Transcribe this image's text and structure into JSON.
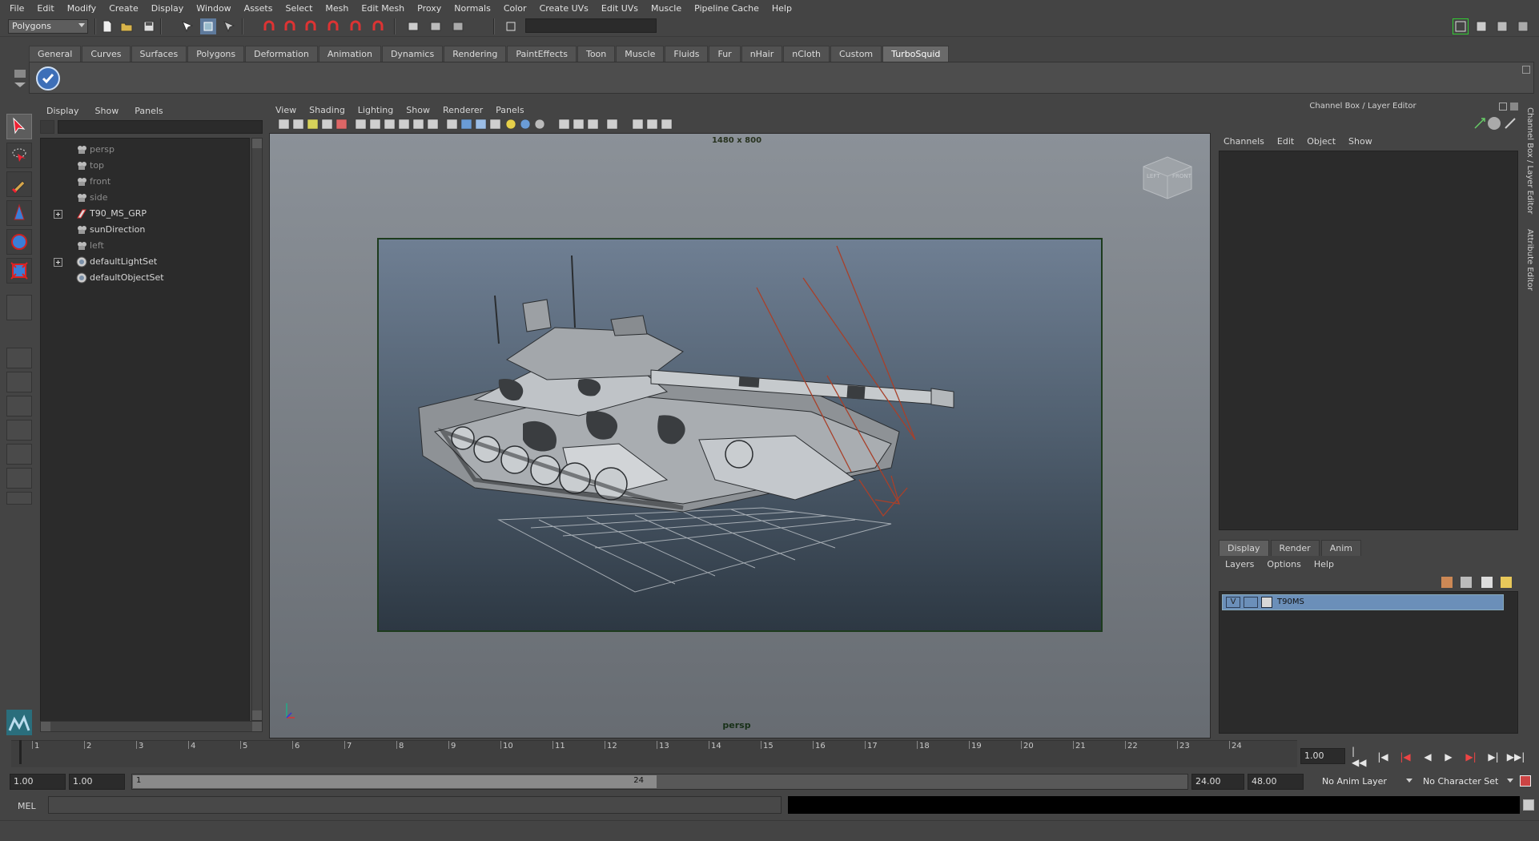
{
  "menubar": [
    "File",
    "Edit",
    "Modify",
    "Create",
    "Display",
    "Window",
    "Assets",
    "Select",
    "Mesh",
    "Edit Mesh",
    "Proxy",
    "Normals",
    "Color",
    "Create UVs",
    "Edit UVs",
    "Muscle",
    "Pipeline Cache",
    "Help"
  ],
  "status": {
    "menu_set": "Polygons"
  },
  "shelf": {
    "tabs": [
      "General",
      "Curves",
      "Surfaces",
      "Polygons",
      "Deformation",
      "Animation",
      "Dynamics",
      "Rendering",
      "PaintEffects",
      "Toon",
      "Muscle",
      "Fluids",
      "Fur",
      "nHair",
      "nCloth",
      "Custom",
      "TurboSquid"
    ],
    "active_tab": "TurboSquid"
  },
  "outliner": {
    "menu": [
      "Display",
      "Show",
      "Panels"
    ],
    "items": [
      {
        "label": "persp",
        "expandable": false,
        "hidden": true
      },
      {
        "label": "top",
        "expandable": false,
        "hidden": true
      },
      {
        "label": "front",
        "expandable": false,
        "hidden": true
      },
      {
        "label": "side",
        "expandable": false,
        "hidden": true
      },
      {
        "label": "T90_MS_GRP",
        "expandable": true,
        "hidden": false
      },
      {
        "label": "sunDirection",
        "expandable": false,
        "hidden": false
      },
      {
        "label": "left",
        "expandable": false,
        "hidden": true
      },
      {
        "label": "defaultLightSet",
        "expandable": true,
        "hidden": false
      },
      {
        "label": "defaultObjectSet",
        "expandable": false,
        "hidden": false
      }
    ]
  },
  "viewport": {
    "menu": [
      "View",
      "Shading",
      "Lighting",
      "Show",
      "Renderer",
      "Panels"
    ],
    "resolution": "1480 x 800",
    "camera": "persp",
    "viewcube_left": "LEFT",
    "viewcube_front": "FRONT"
  },
  "channel_box": {
    "title": "Channel Box / Layer Editor",
    "menu": [
      "Channels",
      "Edit",
      "Object",
      "Show"
    ]
  },
  "layer_editor": {
    "tabs": [
      "Display",
      "Render",
      "Anim"
    ],
    "active_tab": "Display",
    "menu": [
      "Layers",
      "Options",
      "Help"
    ],
    "layers": [
      {
        "visible": "V",
        "name": "T90MS"
      }
    ]
  },
  "side_tabs": [
    "Channel Box / Layer Editor",
    "Attribute Editor"
  ],
  "timeline": {
    "ticks": [
      "1",
      "2",
      "3",
      "4",
      "5",
      "6",
      "7",
      "8",
      "9",
      "10",
      "11",
      "12",
      "13",
      "14",
      "15",
      "16",
      "17",
      "18",
      "19",
      "20",
      "21",
      "22",
      "23",
      "24"
    ],
    "current_frame": "1.00"
  },
  "range": {
    "start_time": "1.00",
    "range_start": "1.00",
    "slider_start": "1",
    "slider_end": "24",
    "range_end": "24.00",
    "end_time": "48.00",
    "anim_layer": "No Anim Layer",
    "character_set": "No Character Set"
  },
  "command": {
    "label": "MEL"
  },
  "colors": {
    "accent_layer": "#6b8fb9",
    "panel_bg": "#444444",
    "field_bg": "#2b2b2b"
  }
}
